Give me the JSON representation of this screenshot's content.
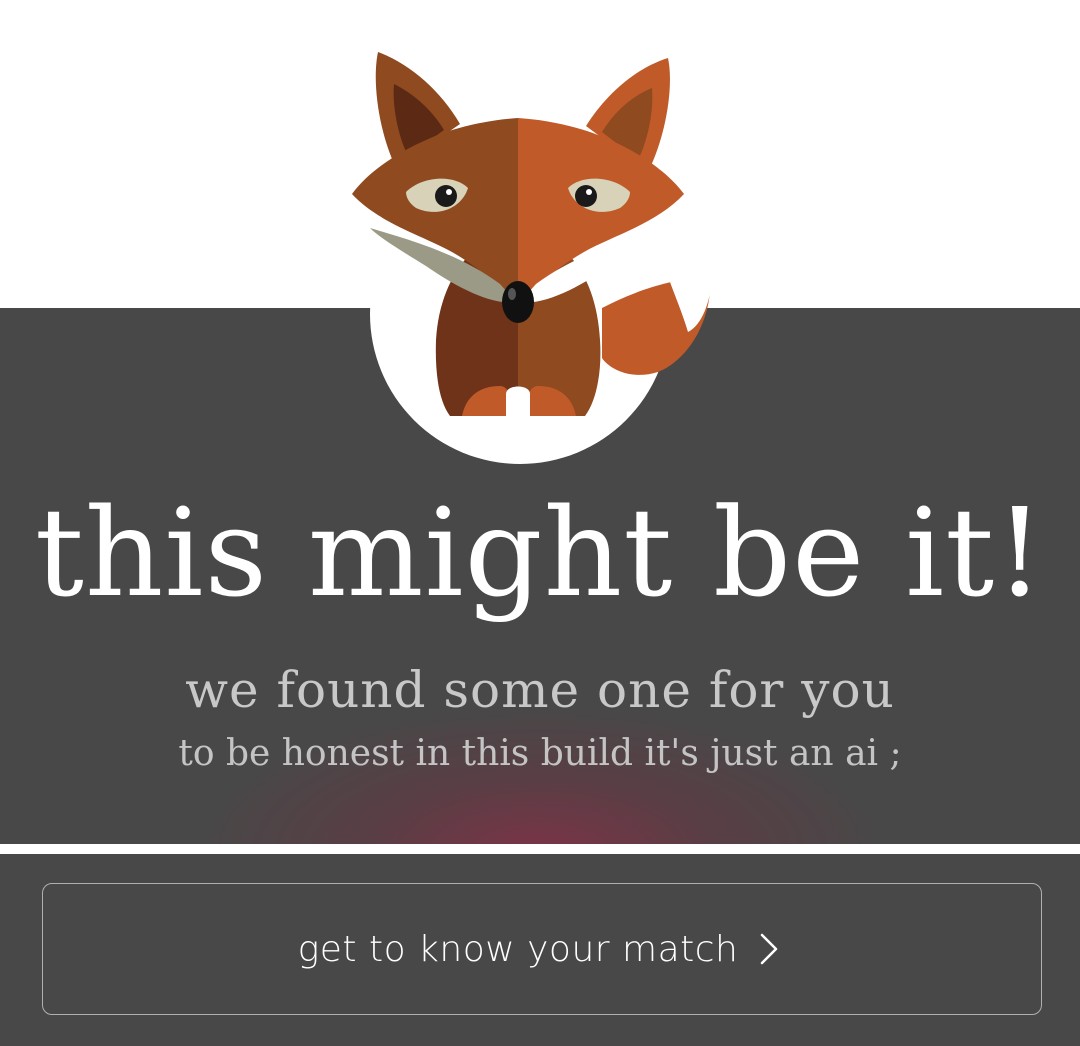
{
  "hero": {
    "illustration": "fox-mascot-icon",
    "headline": "this might be it!",
    "subheadline": "we found some one for you",
    "note": "to be honest in this build it's just an ai ;"
  },
  "action": {
    "label": "get to know your match",
    "icon": "chevron-right-icon"
  },
  "colors": {
    "panel": "#484848",
    "background": "#ffffff",
    "fox_dark": "#8f4a20",
    "fox_light": "#bd5a29",
    "glow": "#8c2d46"
  }
}
